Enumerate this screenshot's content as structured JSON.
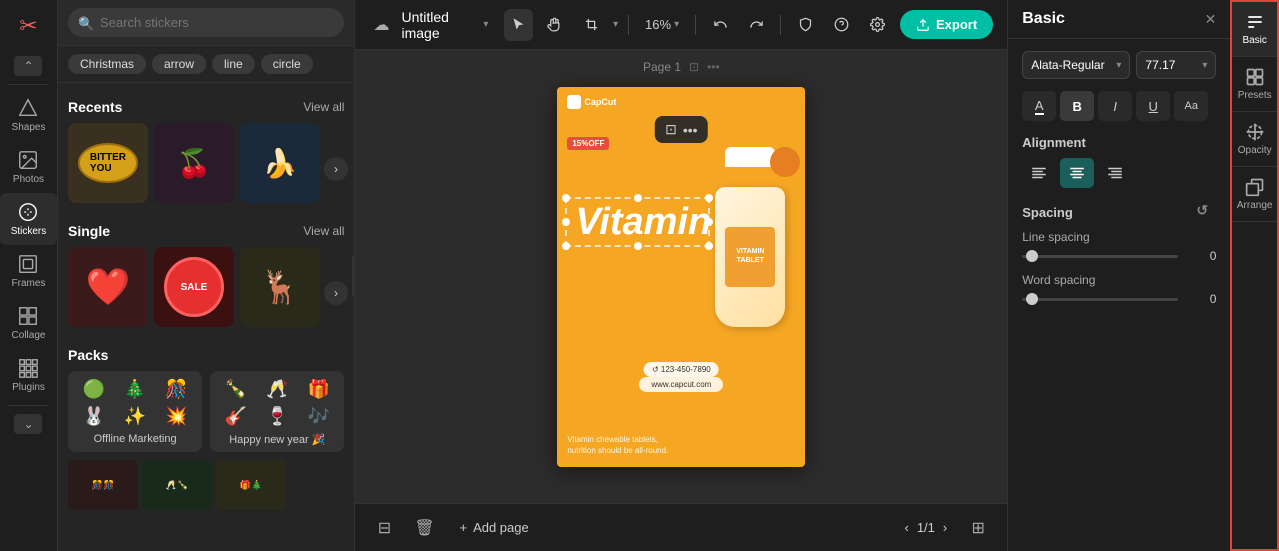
{
  "app": {
    "logo": "✂",
    "title": "Untitled image",
    "zoom": "16%",
    "export_label": "Export"
  },
  "sidebar": {
    "items": [
      {
        "id": "shapes",
        "label": "Shapes",
        "icon": "⬡"
      },
      {
        "id": "photos",
        "label": "Photos",
        "icon": "🖼"
      },
      {
        "id": "stickers",
        "label": "Stickers",
        "icon": "😊",
        "active": true
      },
      {
        "id": "frames",
        "label": "Frames",
        "icon": "⬜"
      },
      {
        "id": "collage",
        "label": "Collage",
        "icon": "⊞"
      },
      {
        "id": "plugins",
        "label": "Plugins",
        "icon": "⚏"
      }
    ]
  },
  "stickers_panel": {
    "search_placeholder": "Search stickers",
    "tags": [
      "Christmas",
      "arrow",
      "line",
      "circle"
    ],
    "sections": {
      "recents": {
        "title": "Recents",
        "view_all": "View all",
        "items": [
          "🏷️",
          "🍒",
          "🍌"
        ]
      },
      "single": {
        "title": "Single",
        "view_all": "View all",
        "items": [
          "❤️",
          "🏷️",
          "🦌"
        ]
      },
      "packs": {
        "title": "Packs",
        "items": [
          {
            "name": "Offline Marketing",
            "stickers": [
              "🟢",
              "🎄",
              "🎊",
              "🐰",
              "✨",
              "💥"
            ]
          },
          {
            "name": "Happy new year 🎉",
            "stickers": [
              "🍾",
              "🥂",
              "🎁",
              "🎸",
              "🍷",
              "🎶"
            ]
          }
        ]
      }
    }
  },
  "canvas": {
    "page_label": "Page 1",
    "design": {
      "logo": "CapCut",
      "badge": "15%OFF",
      "main_text": "Vitamin",
      "phone": "123-450-7890",
      "website": "www.capcut.com",
      "desc_line1": "Vitamin chewable tablets,",
      "desc_line2": "nutrition should be all-round."
    },
    "add_page": "Add page",
    "page_nav": "1/1"
  },
  "properties": {
    "title": "Basic",
    "font": {
      "name": "Alata-Regular",
      "size": "77.17"
    },
    "format_buttons": [
      {
        "id": "underline-color",
        "icon": "A",
        "sub": "underline"
      },
      {
        "id": "bold",
        "icon": "B"
      },
      {
        "id": "italic",
        "icon": "I"
      },
      {
        "id": "underline",
        "icon": "U"
      },
      {
        "id": "size-adjust",
        "icon": "Aa"
      }
    ],
    "alignment": {
      "title": "Alignment",
      "options": [
        "align-left",
        "align-center",
        "align-right"
      ]
    },
    "spacing": {
      "title": "Spacing",
      "line_spacing": {
        "label": "Line spacing",
        "value": "0"
      },
      "word_spacing": {
        "label": "Word spacing",
        "value": "0"
      }
    }
  },
  "right_tabs": [
    {
      "id": "basic",
      "label": "Basic",
      "active": true
    },
    {
      "id": "presets",
      "label": "Presets"
    },
    {
      "id": "opacity",
      "label": "Opacity"
    },
    {
      "id": "arrange",
      "label": "Arrange"
    }
  ]
}
